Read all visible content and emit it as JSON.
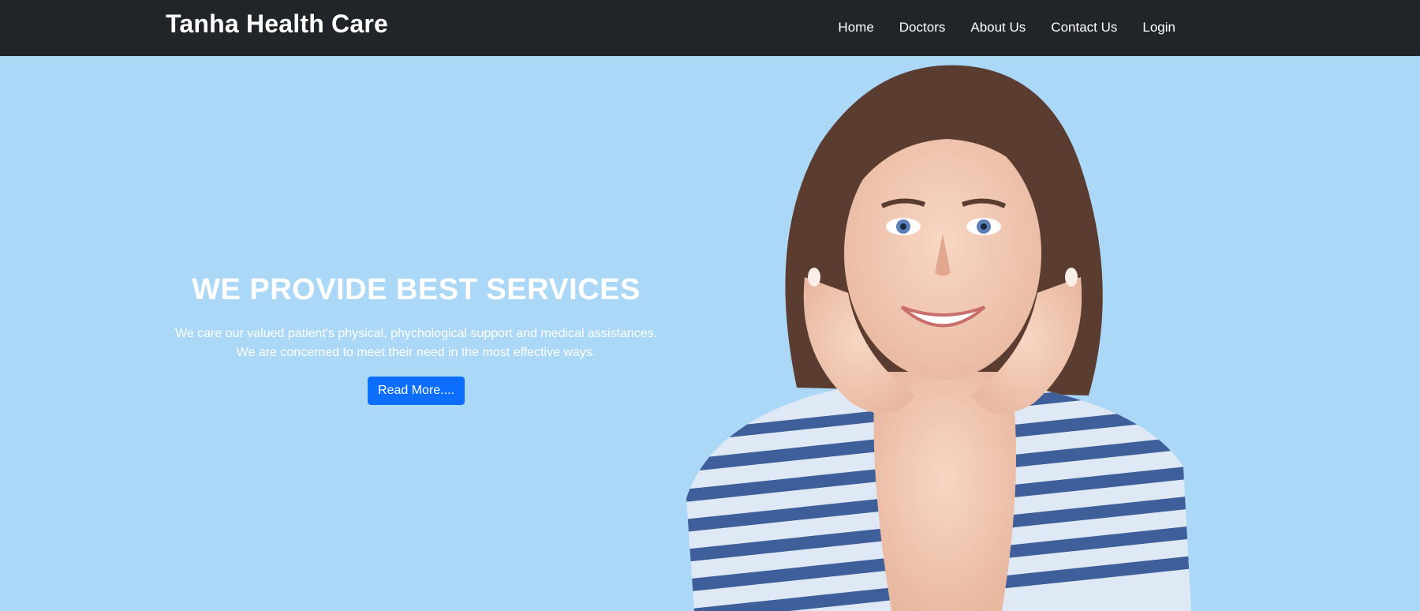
{
  "navbar": {
    "brand": "Tanha Health Care",
    "links": [
      "Home",
      "Doctors",
      "About Us",
      "Contact Us",
      "Login"
    ]
  },
  "hero": {
    "title": "WE PROVIDE BEST SERVICES",
    "description": "We care our valued patient's physical, phychological support and medical assistances. We are concerned to meet their need in the most effective ways.",
    "button_label": "Read More....",
    "image_alt": "smiling-woman-portrait"
  },
  "colors": {
    "navbar_bg": "#212529",
    "hero_bg": "#abd8f7",
    "button_bg": "#0d6efd",
    "text": "#ffffff"
  }
}
